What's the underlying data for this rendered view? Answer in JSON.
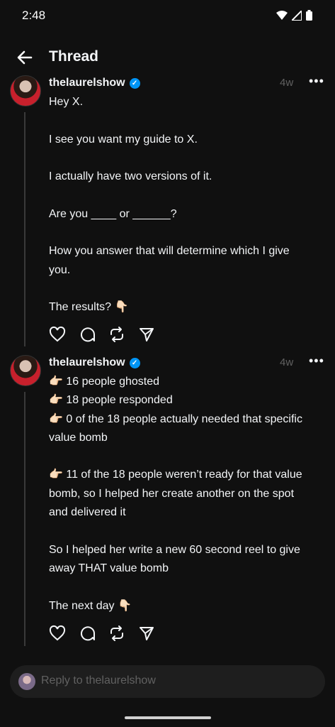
{
  "status_bar": {
    "time": "2:48"
  },
  "header": {
    "title": "Thread"
  },
  "posts": [
    {
      "username": "thelaurelshow",
      "ago": "4w",
      "lines": [
        "Hey X.",
        "",
        "I see you want my guide to X.",
        "",
        "I actually have two versions of it.",
        "",
        "Are you ____ or ______?",
        "",
        "How you answer that will determine which I give",
        "you.",
        "",
        "The results? 👇🏻"
      ]
    },
    {
      "username": "thelaurelshow",
      "ago": "4w",
      "lines": [
        "👉🏻 16 people ghosted",
        "👉🏻 18 people responded",
        "👉🏻 0 of the 18 people actually needed that specific",
        "value bomb",
        "",
        "👉🏻 11 of the 18 people weren’t ready for that value",
        "bomb, so I helped her create another on the spot",
        "and delivered it",
        "",
        "So I helped her write a new 60 second reel to give",
        "away THAT value bomb",
        "",
        "The next day 👇🏻"
      ]
    }
  ],
  "reply": {
    "placeholder": "Reply to thelaurelshow"
  },
  "icons": {
    "back": "arrow-left-icon",
    "more": "more-horizontal-icon",
    "like": "heart-icon",
    "comment": "comment-bubble-icon",
    "repost": "repost-icon",
    "share": "send-icon",
    "verified": "verified-badge-icon"
  },
  "colors": {
    "background": "#101010",
    "text": "#f3f5f7",
    "muted": "#616161",
    "verified": "#0095f6"
  }
}
